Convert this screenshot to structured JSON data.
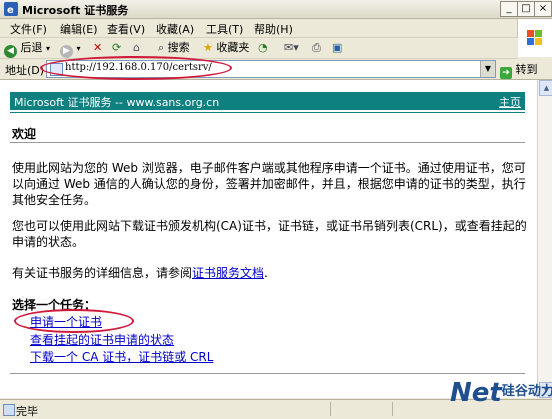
{
  "window": {
    "title": "Microsoft 证书服务"
  },
  "menu": {
    "items": [
      "文件(F)",
      "编辑(E)",
      "查看(V)",
      "收藏(A)",
      "工具(T)",
      "帮助(H)"
    ]
  },
  "toolbar": {
    "back": "后退",
    "search": "搜索",
    "favorites": "收藏夹"
  },
  "address": {
    "label": "地址(D)",
    "url": "http://192.168.0.170/certsrv/",
    "go": "转到"
  },
  "page": {
    "banner_title": "Microsoft 证书服务 -- www.sans.org.cn",
    "home": "主页",
    "heading": "欢迎",
    "para1": "使用此网站为您的 Web 浏览器，电子邮件客户端或其他程序申请一个证书。通过使用证书，您可以向通过 Web 通信的人确认您的身份，签署并加密邮件，并且，根据您申请的证书的类型，执行其他安全任务。",
    "para2": "您也可以使用此网站下载证书颁发机构(CA)证书，证书链，或证书吊销列表(CRL)，或查看挂起的申请的状态。",
    "para3_prefix": "有关证书服务的详细信息，请参阅",
    "para3_link": "证书服务文档",
    "para3_suffix": ".",
    "task_heading": "选择一个任务：",
    "tasks": [
      "申请一个证书",
      "查看挂起的证书申请的状态",
      "下载一个 CA 证书，证书链或 CRL"
    ]
  },
  "status": {
    "text": "完毕"
  },
  "watermark": {
    "main": "Net",
    "sub": "硅谷动力"
  },
  "colors": {
    "banner": "#0f8080",
    "link": "#0000cc",
    "annotation": "#d01a3a"
  }
}
